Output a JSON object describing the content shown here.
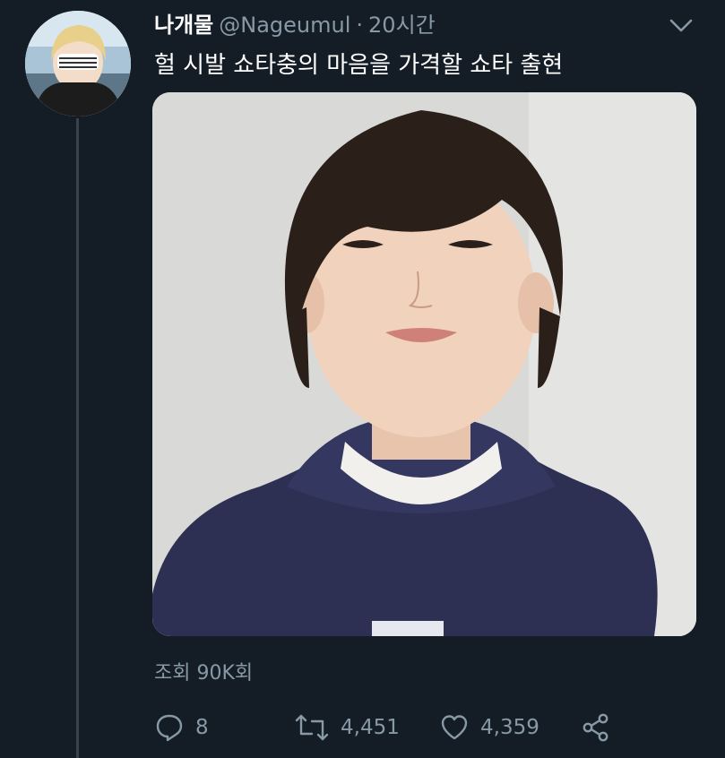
{
  "tweet": {
    "display_name": "나개물",
    "handle": "@Nageumul",
    "separator": "·",
    "timestamp": "20시간",
    "text": "헐 시발 쇼타충의 마음을 가격할 쇼타 출현",
    "views": "조회 90K회"
  },
  "actions": {
    "reply_count": "8",
    "retweet_count": "4,451",
    "like_count": "4,359"
  },
  "colors": {
    "background": "#141d26",
    "primary_text": "#ffffff",
    "secondary_text": "#8899a6",
    "thread_line": "#38444d"
  },
  "icons": [
    "chevron-down-icon",
    "reply-icon",
    "retweet-icon",
    "like-icon",
    "share-icon"
  ]
}
